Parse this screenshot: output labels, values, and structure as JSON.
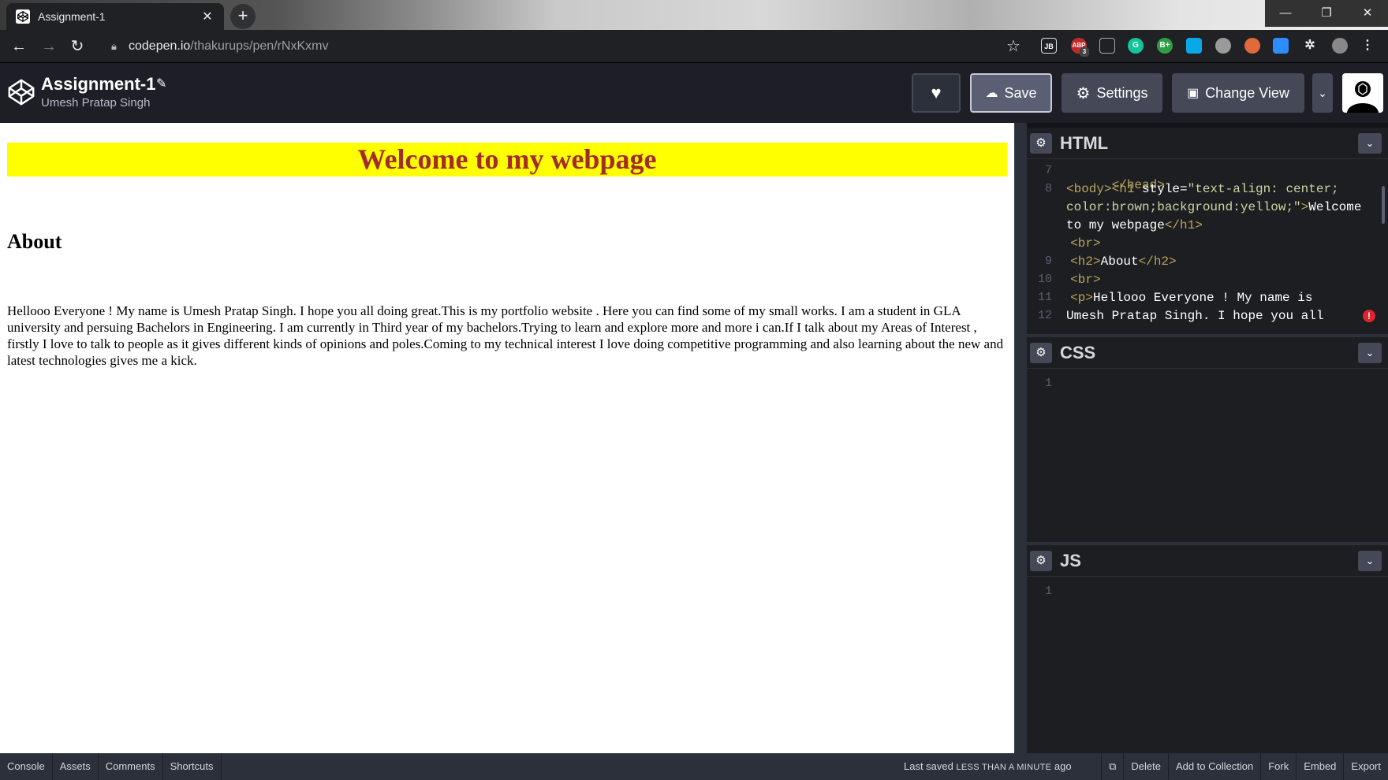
{
  "browser": {
    "tab_title": "Assignment-1",
    "tab_close": "✕",
    "new_tab": "+",
    "url_host": "codepen.io",
    "url_path": "/thakurups/pen/rNxKxmv",
    "window_controls": [
      "—",
      "❐",
      "✕"
    ],
    "ext_abp_badge": "3"
  },
  "header": {
    "pen_title": "Assignment-1",
    "author": "Umesh Pratap Singh",
    "save_label": "Save",
    "settings_label": "Settings",
    "change_view_label": "Change View"
  },
  "preview": {
    "h1": "Welcome to my webpage",
    "h2": "About",
    "paragraph": "Hellooo Everyone ! My name is Umesh Pratap Singh. I hope you all doing great.This is my portfolio website . Here you can find some of my small works. I am a student in GLA university and persuing Bachelors in Engineering. I am currently in Third year of my bachelors.Trying to learn and explore more and more i can.If I talk about my Areas of Interest , firstly I love to talk to people as it gives different kinds of opinions and poles.Coming to my technical interest I love doing competitive programming and also learning about the new and latest technologies gives me a kick."
  },
  "editors": {
    "html": {
      "title": "HTML",
      "line_numbers": [
        "7",
        "8",
        "",
        "",
        "9",
        "10",
        "11",
        "12"
      ],
      "lines": [
        {
          "tag": "</head>"
        },
        {
          "tag": "<body><h1 ",
          "att": "style=",
          "str": "\"text-align: center;"
        },
        {
          "str": "color:brown;background:yellow;\"",
          "tag": ">",
          "txt": "Welcome"
        },
        {
          "txt": "to my webpage",
          "tag": "</h1>"
        },
        {
          "tag": "  <br>"
        },
        {
          "tag": "  <h2>",
          "txt": "About",
          "tag2": "</h2>"
        },
        {
          "tag": "  <br>"
        },
        {
          "tag": "  <p>",
          "txt": "Hellooo Everyone ! My name is"
        },
        {
          "txt": "Umesh Pratap Singh. I hope you all"
        }
      ]
    },
    "css": {
      "title": "CSS",
      "line_numbers": [
        "1"
      ]
    },
    "js": {
      "title": "JS",
      "line_numbers": [
        "1"
      ]
    }
  },
  "footer": {
    "left": [
      "Console",
      "Assets",
      "Comments",
      "Shortcuts"
    ],
    "last_saved_prefix": "Last saved",
    "last_saved_caps": "less than a minute",
    "last_saved_suffix": "ago",
    "right": [
      "Delete",
      "Add to Collection",
      "Fork",
      "Embed",
      "Export"
    ]
  },
  "colors": {
    "codepen_header": "#1e1f26",
    "button": "#444857",
    "preview_h1_bg": "#ffff00",
    "preview_h1_fg": "#a52a2a",
    "error": "#e0242f"
  }
}
